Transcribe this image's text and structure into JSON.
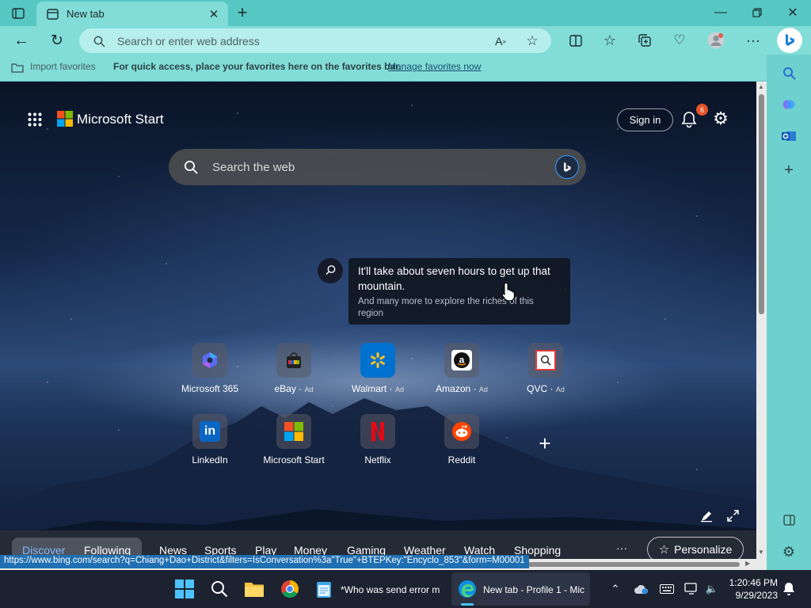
{
  "tab": {
    "title": "New tab"
  },
  "address": {
    "placeholder": "Search or enter web address"
  },
  "favorites_bar": {
    "import_label": "Import favorites",
    "message": "For quick access, place your favorites here on the favorites bar.",
    "manage_link": "Manage favorites now"
  },
  "ms_start": {
    "brand": "Microsoft Start",
    "signin_label": "Sign in",
    "notifications_count": "6",
    "search_placeholder": "Search the web"
  },
  "tooltip": {
    "headline": "It'll take about seven hours to get up that mountain.",
    "subtext": "And many more to explore the riches of this region"
  },
  "quick_links": [
    {
      "label": "Microsoft 365",
      "ad": ""
    },
    {
      "label": "eBay",
      "ad": "Ad"
    },
    {
      "label": "Walmart",
      "ad": "Ad"
    },
    {
      "label": "Amazon",
      "ad": "Ad"
    },
    {
      "label": "QVC",
      "ad": "Ad"
    },
    {
      "label": "LinkedIn",
      "ad": ""
    },
    {
      "label": "Microsoft Start",
      "ad": ""
    },
    {
      "label": "Netflix",
      "ad": ""
    },
    {
      "label": "Reddit",
      "ad": ""
    }
  ],
  "feed_nav": {
    "discover": "Discover",
    "following": "Following",
    "items": [
      "News",
      "Sports",
      "Play",
      "Money",
      "Gaming",
      "Weather",
      "Watch",
      "Shopping"
    ],
    "more": "···",
    "personalize": "Personalize"
  },
  "status_url": "https://www.bing.com/search?q=Chiang+Dao+District&filters=IsConversation%3a\"True\"+BTEPKey:\"Encyclo_853\"&form=M00001",
  "taskbar": {
    "notepad_label": "*Who was send error m",
    "edge_label": "New tab - Profile 1 - Mic",
    "time": "1:20:46 PM",
    "date": "9/29/2023"
  },
  "colors": {
    "tabbar": "#56c7c3",
    "toolbar": "#82dcd8",
    "accent": "#1f6fb2",
    "badge": "#e4542a"
  }
}
